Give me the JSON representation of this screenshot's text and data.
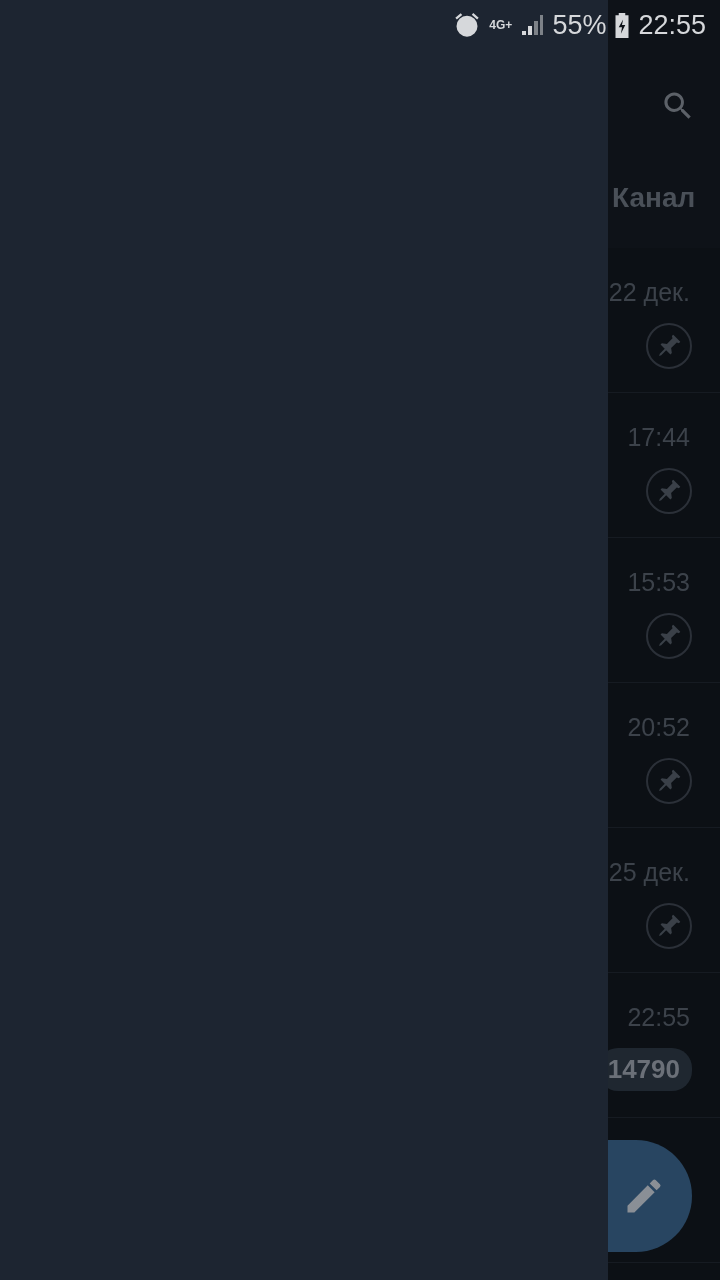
{
  "status_bar": {
    "network": "4G+",
    "battery": "55%",
    "time": "22:55"
  },
  "header": {
    "tab_label": "Канал"
  },
  "chats": [
    {
      "time": "22 дек.",
      "pinned": true
    },
    {
      "time": "17:44",
      "pinned": true
    },
    {
      "time": "15:53",
      "pinned": true
    },
    {
      "time": "20:52",
      "pinned": true
    },
    {
      "time": "25 дек.",
      "pinned": true
    },
    {
      "time": "22:55",
      "pinned": false,
      "unread": "14790"
    }
  ]
}
